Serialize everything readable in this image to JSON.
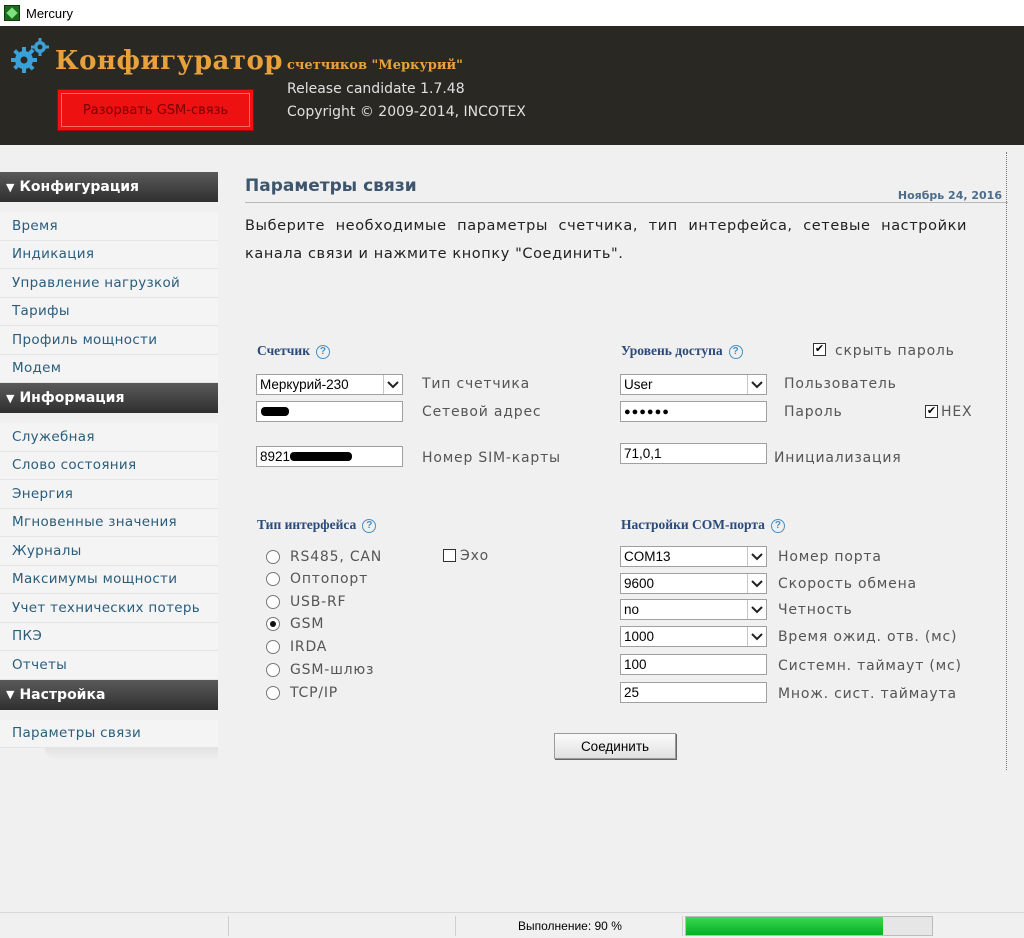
{
  "window": {
    "title": "Mercury"
  },
  "header": {
    "brand": "Конфигуратор",
    "subtitle": "счетчиков \"Меркурий\"",
    "release": "Release candidate 1.7.48",
    "copyright": "Copyright © 2009-2014, INCOTEX",
    "gsm_button": "Разорвать GSM-связь"
  },
  "sidebar": {
    "sections": [
      {
        "title": "Конфигурация",
        "items": [
          "Время",
          "Индикация",
          "Управление нагрузкой",
          "Тарифы",
          "Профиль мощности",
          "Модем"
        ]
      },
      {
        "title": "Информация",
        "items": [
          "Служебная",
          "Слово состояния",
          "Энергия",
          "Мгновенные значения",
          "Журналы",
          "Максимумы мощности",
          "Учет технических потерь",
          "ПКЭ",
          "Отчеты"
        ]
      },
      {
        "title": "Настройка",
        "items": [
          "Параметры связи"
        ]
      }
    ]
  },
  "main": {
    "title": "Параметры связи",
    "date": "Ноябрь 24, 2016",
    "intro": "Выберите необходимые параметры счетчика, тип интерфейса, сетевые настройки канала связи и нажмите кнопку \"Соединить\".",
    "meter": {
      "heading": "Счетчик",
      "type_value": "Меркурий-230",
      "type_label": "Тип счетчика",
      "address_label": "Сетевой адрес",
      "sim_value": "8921",
      "sim_label": "Номер SIM-карты"
    },
    "access": {
      "heading": "Уровень доступа",
      "hide_password_label": "скрыть пароль",
      "hide_password_checked": true,
      "user_value": "User",
      "user_label": "Пользователь",
      "password_value": "●●●●●●",
      "password_label": "Пароль",
      "hex_label": "HEX",
      "hex_checked": true,
      "init_value": "71,0,1",
      "init_label": "Инициализация"
    },
    "interface": {
      "heading": "Тип интерфейса",
      "echo_label": "Эхо",
      "echo_checked": false,
      "options": [
        "RS485, CAN",
        "Оптопорт",
        "USB-RF",
        "GSM",
        "IRDA",
        "GSM-шлюз",
        "TCP/IP"
      ],
      "selected": "GSM"
    },
    "com": {
      "heading": "Настройки COM-порта",
      "port_value": "COM13",
      "port_label": "Номер порта",
      "speed_value": "9600",
      "speed_label": "Скорость обмена",
      "parity_value": "no",
      "parity_label": "Четность",
      "wait_value": "1000",
      "wait_label": "Время ожид. отв. (мс)",
      "sys_timeout_value": "100",
      "sys_timeout_label": "Системн. таймаут (мс)",
      "mult_value": "25",
      "mult_label": "Множ. сист. таймаута"
    },
    "connect_button": "Соединить"
  },
  "statusbar": {
    "text": "Выполнение: 90 %",
    "progress": 0.8,
    "progress_color": "#06b025"
  },
  "colors": {
    "header_bg": "#292823",
    "brand": "#e9a23b",
    "gsm_button": "#ee1111",
    "nav_link": "#2a5d7c",
    "heading_blue": "#2b4a7a"
  }
}
